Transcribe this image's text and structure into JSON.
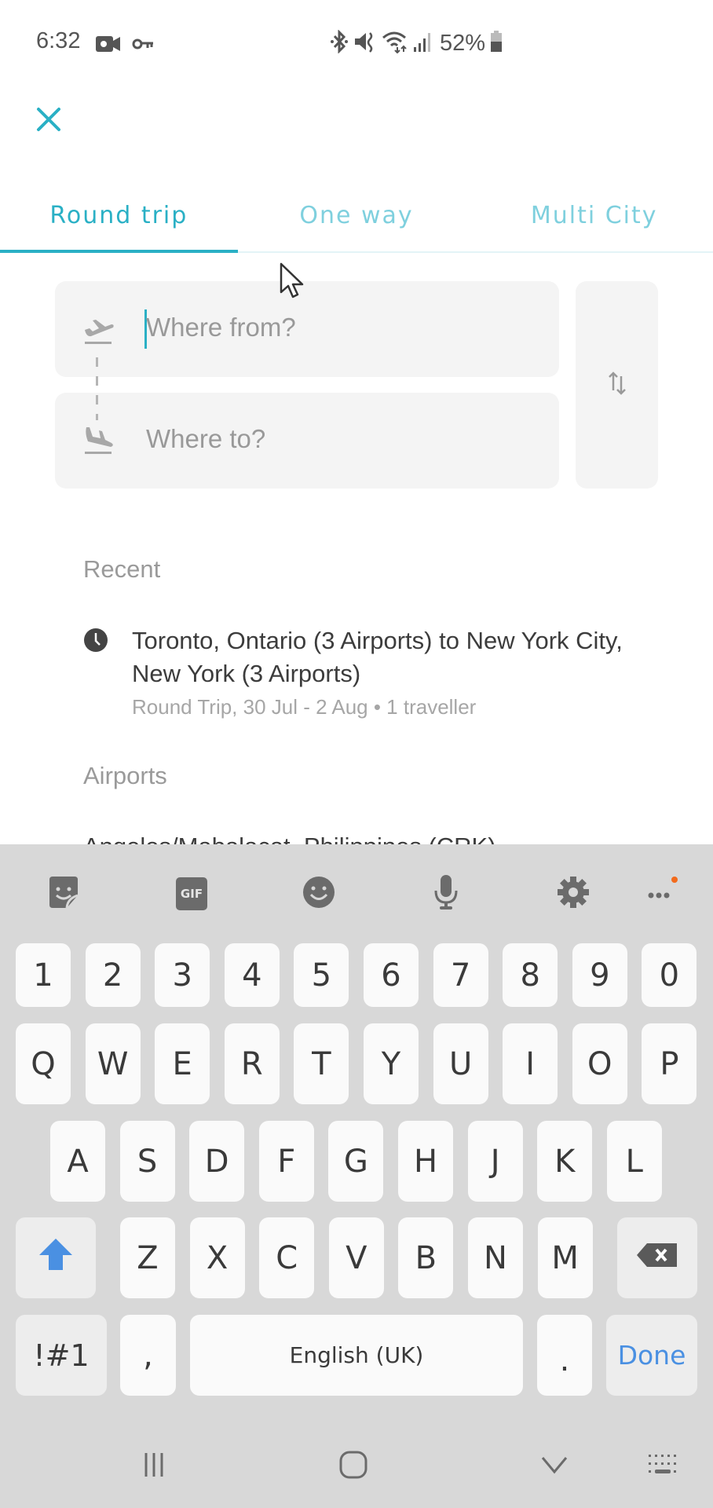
{
  "status_bar": {
    "time": "6:32",
    "battery_percent": "52%",
    "left_icons": [
      "video-recording-icon",
      "vpn-key-icon"
    ],
    "right_icons": [
      "bluetooth-icon",
      "mute-vibrate-icon",
      "wifi-icon",
      "signal-icon",
      "battery-icon"
    ]
  },
  "header": {
    "close_icon": "close-icon"
  },
  "tabs": [
    {
      "label": "Round trip",
      "active": true
    },
    {
      "label": "One way",
      "active": false
    },
    {
      "label": "Multi City",
      "active": false
    }
  ],
  "search": {
    "from_placeholder": "Where from?",
    "to_placeholder": "Where to?",
    "swap_icon": "swap-vertical-icon"
  },
  "recent": {
    "heading": "Recent",
    "items": [
      {
        "title": "Toronto, Ontario (3 Airports) to New York City, New York (3 Airports)",
        "subtitle": "Round Trip, 30 Jul - 2 Aug • 1 traveller"
      }
    ]
  },
  "airports": {
    "heading": "Airports",
    "items": [
      "Angeles/Mabalacat, Philippines (CRK)"
    ]
  },
  "keyboard": {
    "toolbar": [
      "sticker-icon",
      "gif-icon",
      "emoji-icon",
      "microphone-icon",
      "settings-icon",
      "more-icon"
    ],
    "gif_label": "GIF",
    "row_numbers": [
      "1",
      "2",
      "3",
      "4",
      "5",
      "6",
      "7",
      "8",
      "9",
      "0"
    ],
    "row_1": [
      "Q",
      "W",
      "E",
      "R",
      "T",
      "Y",
      "U",
      "I",
      "O",
      "P"
    ],
    "row_2": [
      "A",
      "S",
      "D",
      "F",
      "G",
      "H",
      "J",
      "K",
      "L"
    ],
    "row_3": [
      "Z",
      "X",
      "C",
      "V",
      "B",
      "N",
      "M"
    ],
    "symbols_label": "!#1",
    "comma_label": ",",
    "space_label": "English (UK)",
    "period_label": ".",
    "done_label": "Done",
    "accent_color": "#4a90e2"
  },
  "nav_bar": [
    "recent-apps-icon",
    "home-icon",
    "back-icon",
    "keyboard-switch-icon"
  ],
  "colors": {
    "brand": "#2ab0c5",
    "tab_inactive": "#7fd0de",
    "notification_dot": "#f26b1d"
  }
}
